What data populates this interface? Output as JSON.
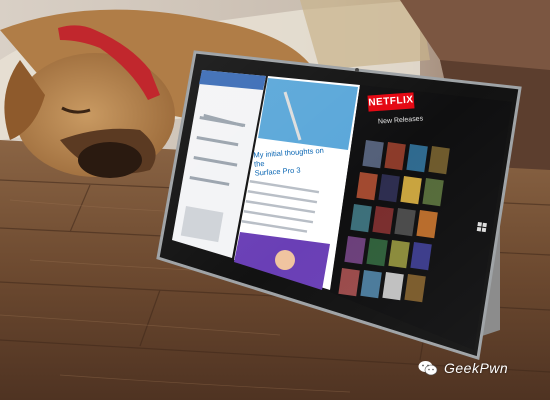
{
  "screen": {
    "netflix_logo": "NETFLIX",
    "netflix_section": "New Releases",
    "article_headline_line1": "My initial thoughts on the",
    "article_headline_line2": "Surface Pro 3"
  },
  "watermark": {
    "text": "GeekPwn",
    "icon": "wechat-icon"
  },
  "colors": {
    "netflix_red": "#e50914",
    "floor_wood": "#6b4a33",
    "tablet_bezel": "#121212",
    "dog_fur": "#b5834c",
    "collar": "#c1272d"
  }
}
